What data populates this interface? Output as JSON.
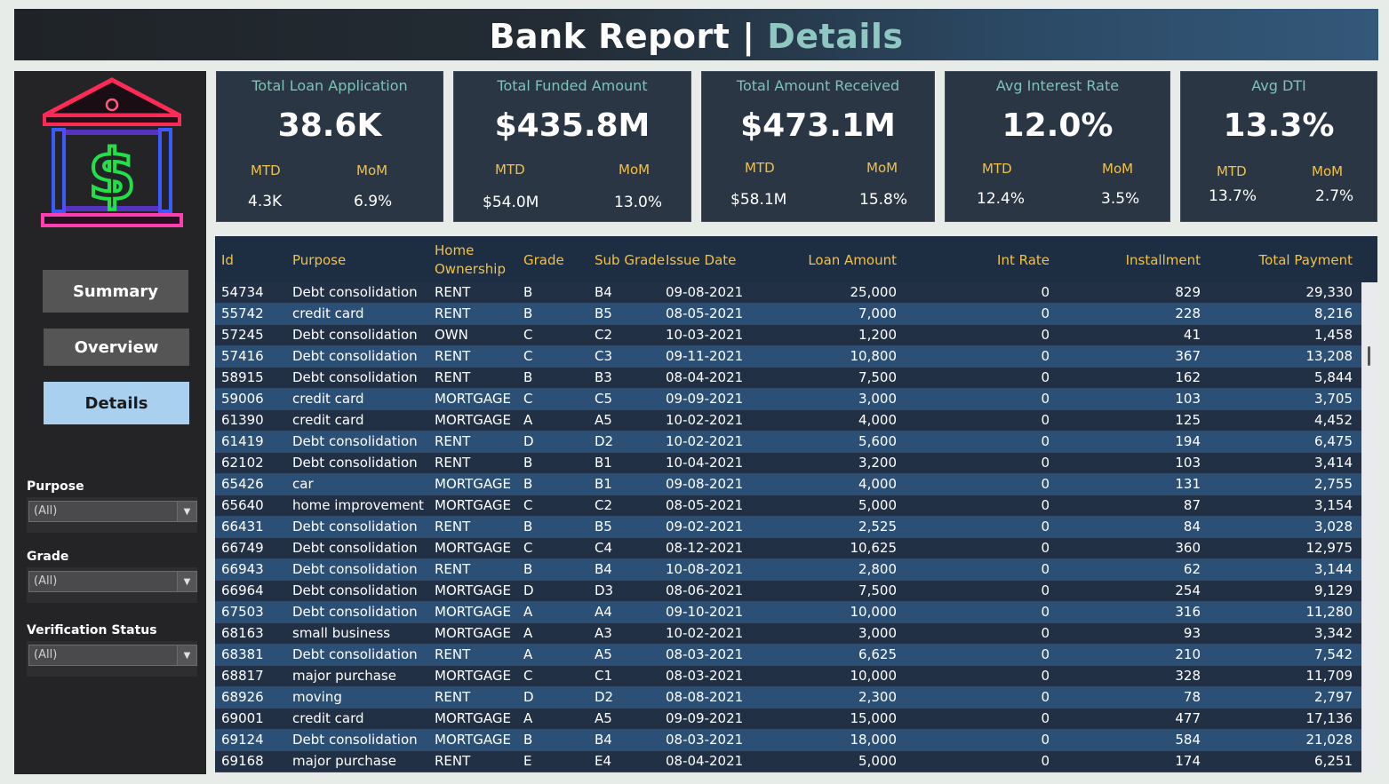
{
  "header": {
    "title": "Bank Report",
    "separator": "|",
    "subtitle": "Details"
  },
  "nav": {
    "summary": "Summary",
    "overview": "Overview",
    "details": "Details",
    "active": "Details"
  },
  "filters": [
    {
      "label": "Purpose",
      "value": "(All)"
    },
    {
      "label": "Grade",
      "value": "(All)"
    },
    {
      "label": "Verification Status",
      "value": "(All)"
    }
  ],
  "logo": {
    "icon": "bank-dollar-icon",
    "symbol": "$",
    "colors": {
      "roof": "#ff2a55",
      "pillars": "#3a5bff",
      "dollar": "#22e04a",
      "base": "#ff3fb0"
    }
  },
  "kpis": [
    {
      "title": "Total Loan Application",
      "value": "38.6K",
      "mtd_label": "MTD",
      "mom_label": "MoM",
      "mtd": "4.3K",
      "mom": "6.9%"
    },
    {
      "title": "Total Funded Amount",
      "value": "$435.8M",
      "mtd_label": "MTD",
      "mom_label": "MoM",
      "mtd": "$54.0M",
      "mom": "13.0%"
    },
    {
      "title": "Total Amount Received",
      "value": "$473.1M",
      "mtd_label": "MTD",
      "mom_label": "MoM",
      "mtd": "$58.1M",
      "mom": "15.8%"
    },
    {
      "title": "Avg Interest Rate",
      "value": "12.0%",
      "mtd_label": "MTD",
      "mom_label": "MoM",
      "mtd": "12.4%",
      "mom": "3.5%"
    },
    {
      "title": "Avg DTI",
      "value": "13.3%",
      "mtd_label": "MTD",
      "mom_label": "MoM",
      "mtd": "13.7%",
      "mom": "2.7%"
    }
  ],
  "table": {
    "columns": {
      "id": "Id",
      "purpose": "Purpose",
      "home1": "Home",
      "home2": "Ownership",
      "grade": "Grade",
      "subgrade": "Sub Grade",
      "issue": "Issue Date",
      "loan": "Loan Amount",
      "rate": "Int Rate",
      "inst": "Installment",
      "pay": "Total Payment"
    },
    "rows": [
      [
        "54734",
        "Debt consolidation",
        "RENT",
        "B",
        "B4",
        "09-08-2021",
        "25,000",
        "0",
        "829",
        "29,330"
      ],
      [
        "55742",
        "credit card",
        "RENT",
        "B",
        "B5",
        "08-05-2021",
        "7,000",
        "0",
        "228",
        "8,216"
      ],
      [
        "57245",
        "Debt consolidation",
        "OWN",
        "C",
        "C2",
        "10-03-2021",
        "1,200",
        "0",
        "41",
        "1,458"
      ],
      [
        "57416",
        "Debt consolidation",
        "RENT",
        "C",
        "C3",
        "09-11-2021",
        "10,800",
        "0",
        "367",
        "13,208"
      ],
      [
        "58915",
        "Debt consolidation",
        "RENT",
        "B",
        "B3",
        "08-04-2021",
        "7,500",
        "0",
        "162",
        "5,844"
      ],
      [
        "59006",
        "credit card",
        "MORTGAGE",
        "C",
        "C5",
        "09-09-2021",
        "3,000",
        "0",
        "103",
        "3,705"
      ],
      [
        "61390",
        "credit card",
        "MORTGAGE",
        "A",
        "A5",
        "10-02-2021",
        "4,000",
        "0",
        "125",
        "4,452"
      ],
      [
        "61419",
        "Debt consolidation",
        "RENT",
        "D",
        "D2",
        "10-02-2021",
        "5,600",
        "0",
        "194",
        "6,475"
      ],
      [
        "62102",
        "Debt consolidation",
        "RENT",
        "B",
        "B1",
        "10-04-2021",
        "3,200",
        "0",
        "103",
        "3,414"
      ],
      [
        "65426",
        "car",
        "MORTGAGE",
        "B",
        "B1",
        "09-08-2021",
        "4,000",
        "0",
        "131",
        "2,755"
      ],
      [
        "65640",
        "home improvement",
        "MORTGAGE",
        "C",
        "C2",
        "08-05-2021",
        "5,000",
        "0",
        "87",
        "3,154"
      ],
      [
        "66431",
        "Debt consolidation",
        "RENT",
        "B",
        "B5",
        "09-02-2021",
        "2,525",
        "0",
        "84",
        "3,028"
      ],
      [
        "66749",
        "Debt consolidation",
        "MORTGAGE",
        "C",
        "C4",
        "08-12-2021",
        "10,625",
        "0",
        "360",
        "12,975"
      ],
      [
        "66943",
        "Debt consolidation",
        "RENT",
        "B",
        "B4",
        "10-08-2021",
        "2,800",
        "0",
        "62",
        "3,144"
      ],
      [
        "66964",
        "Debt consolidation",
        "MORTGAGE",
        "D",
        "D3",
        "08-06-2021",
        "7,500",
        "0",
        "254",
        "9,129"
      ],
      [
        "67503",
        "Debt consolidation",
        "MORTGAGE",
        "A",
        "A4",
        "09-10-2021",
        "10,000",
        "0",
        "316",
        "11,280"
      ],
      [
        "68163",
        "small business",
        "MORTGAGE",
        "A",
        "A3",
        "10-02-2021",
        "3,000",
        "0",
        "93",
        "3,342"
      ],
      [
        "68381",
        "Debt consolidation",
        "RENT",
        "A",
        "A5",
        "08-03-2021",
        "6,625",
        "0",
        "210",
        "7,542"
      ],
      [
        "68817",
        "major purchase",
        "MORTGAGE",
        "C",
        "C1",
        "08-03-2021",
        "10,000",
        "0",
        "328",
        "11,709"
      ],
      [
        "68926",
        "moving",
        "RENT",
        "D",
        "D2",
        "08-08-2021",
        "2,300",
        "0",
        "78",
        "2,797"
      ],
      [
        "69001",
        "credit card",
        "MORTGAGE",
        "A",
        "A5",
        "09-09-2021",
        "15,000",
        "0",
        "477",
        "17,136"
      ],
      [
        "69124",
        "Debt consolidation",
        "MORTGAGE",
        "B",
        "B4",
        "08-03-2021",
        "18,000",
        "0",
        "584",
        "21,028"
      ],
      [
        "69168",
        "major purchase",
        "RENT",
        "E",
        "E4",
        "08-04-2021",
        "5,000",
        "0",
        "174",
        "6,251"
      ]
    ]
  }
}
